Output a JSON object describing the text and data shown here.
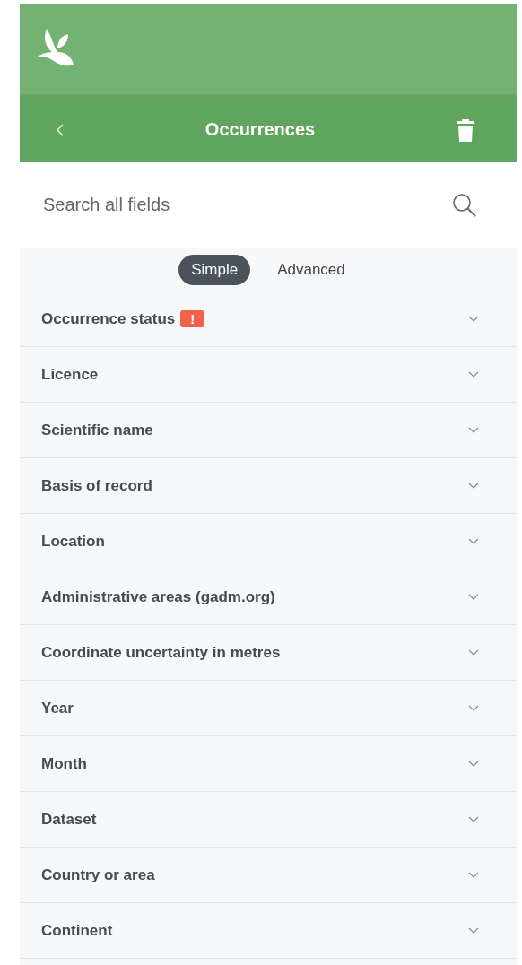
{
  "toolbar": {
    "title": "Occurrences"
  },
  "search": {
    "placeholder": "Search all fields"
  },
  "tabs": [
    {
      "label": "Simple",
      "selected": true
    },
    {
      "label": "Advanced",
      "selected": false
    }
  ],
  "filters": [
    {
      "label": "Occurrence status",
      "badge": "!",
      "expanded": false
    },
    {
      "label": "Licence",
      "expanded": false
    },
    {
      "label": "Scientific name",
      "expanded": false
    },
    {
      "label": "Basis of record",
      "expanded": false
    },
    {
      "label": "Location",
      "expanded": false
    },
    {
      "label": "Administrative areas (gadm.org)",
      "expanded": false
    },
    {
      "label": "Coordinate uncertainty in metres",
      "expanded": false
    },
    {
      "label": "Year",
      "expanded": false
    },
    {
      "label": "Month",
      "expanded": false
    },
    {
      "label": "Dataset",
      "expanded": false
    },
    {
      "label": "Country or area",
      "expanded": false
    },
    {
      "label": "Continent",
      "expanded": false
    }
  ]
}
